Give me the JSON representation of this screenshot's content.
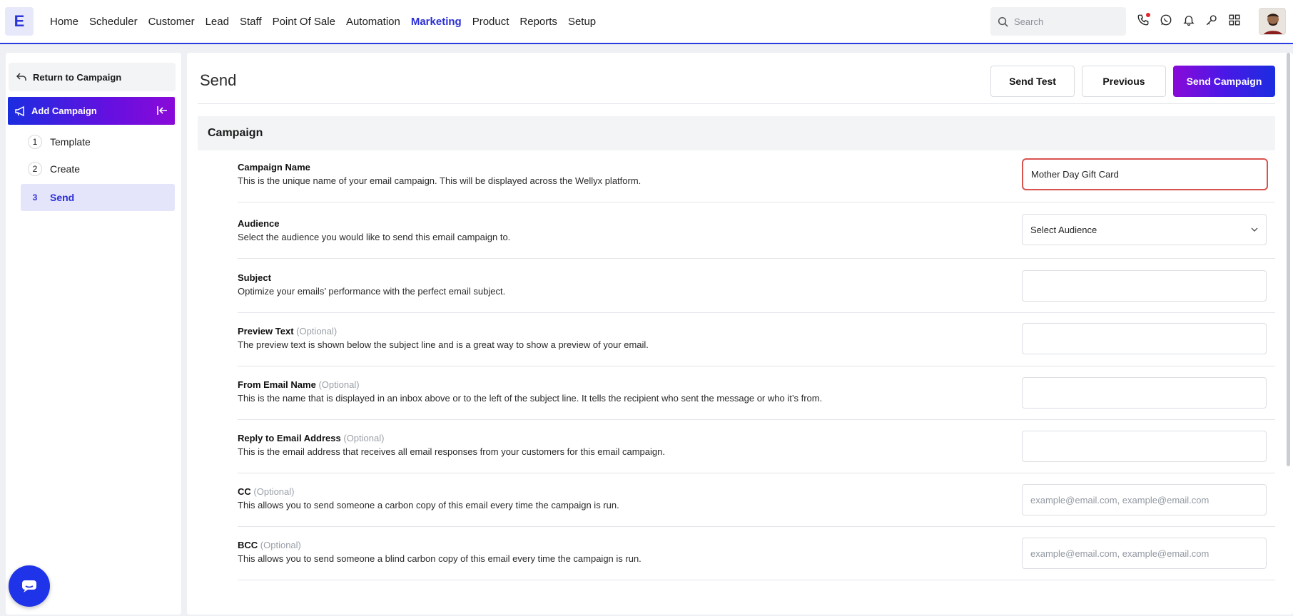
{
  "app": {
    "logo_letter": "E"
  },
  "nav": {
    "items": [
      "Home",
      "Scheduler",
      "Customer",
      "Lead",
      "Staff",
      "Point Of Sale",
      "Automation",
      "Marketing",
      "Product",
      "Reports",
      "Setup"
    ],
    "active": "Marketing"
  },
  "search": {
    "placeholder": "Search"
  },
  "sidebar": {
    "return_label": "Return to Campaign",
    "add_campaign_label": "Add Campaign",
    "steps": [
      {
        "num": "1",
        "label": "Template"
      },
      {
        "num": "2",
        "label": "Create"
      },
      {
        "num": "3",
        "label": "Send"
      }
    ],
    "active_step": "Send"
  },
  "header": {
    "title": "Send",
    "send_test": "Send Test",
    "previous": "Previous",
    "send_campaign": "Send Campaign"
  },
  "section": {
    "title": "Campaign"
  },
  "fields": [
    {
      "label": "Campaign Name",
      "optional": "",
      "desc": "This is the unique name of your email campaign. This will be displayed across the Wellyx platform.",
      "value": "Mother Day Gift Card",
      "placeholder": ""
    },
    {
      "label": "Audience",
      "optional": "",
      "desc": "Select the audience you would like to send this email campaign to.",
      "value": "Select Audience",
      "placeholder": ""
    },
    {
      "label": "Subject",
      "optional": "",
      "desc": "Optimize your emails’ performance with the perfect email subject.",
      "value": "",
      "placeholder": ""
    },
    {
      "label": "Preview Text",
      "optional": "(Optional)",
      "desc": "The preview text is shown below the subject line and is a great way to show a preview of your email.",
      "value": "",
      "placeholder": ""
    },
    {
      "label": "From Email Name",
      "optional": "(Optional)",
      "desc": "This is the name that is displayed in an inbox above or to the left of the subject line. It tells the recipient who sent the message or who it’s from.",
      "value": "",
      "placeholder": ""
    },
    {
      "label": "Reply to Email Address",
      "optional": "(Optional)",
      "desc": "This is the email address that receives all email responses from your customers for this email campaign.",
      "value": "",
      "placeholder": ""
    },
    {
      "label": "CC",
      "optional": "(Optional)",
      "desc": "This allows you to send someone a carbon copy of this email every time the campaign is run.",
      "value": "",
      "placeholder": "example@email.com, example@email.com"
    },
    {
      "label": "BCC",
      "optional": "(Optional)",
      "desc": "This allows you to send someone a blind carbon copy of this email every time the campaign is run.",
      "value": "",
      "placeholder": "example@email.com, example@email.com"
    }
  ],
  "colors": {
    "brand": "#2b2fd6",
    "gradient_start": "#1b2de0",
    "gradient_end": "#8a0ad8",
    "focus_border": "#d9534f"
  }
}
